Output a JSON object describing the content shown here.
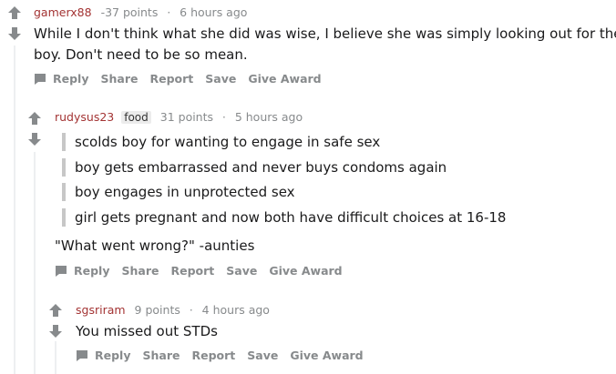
{
  "comments": [
    {
      "author": "gamerx88",
      "points": "-37 points",
      "time": "6 hours ago",
      "body_line1": "While I don't think what she did was wise, I believe she was simply looking out for the",
      "body_line2": "boy. Don't need to be so mean.",
      "actions": {
        "reply": "Reply",
        "share": "Share",
        "report": "Report",
        "save": "Save",
        "award": "Give Award"
      }
    },
    {
      "author": "rudysus23",
      "flair": "food",
      "points": "31 points",
      "time": "5 hours ago",
      "quotes": [
        "scolds boy for wanting to engage in safe sex",
        "boy gets embarrassed and never buys condoms again",
        "boy engages in unprotected sex",
        "girl gets pregnant and now both have difficult choices at 16-18"
      ],
      "body": "\"What went wrong?\" -aunties",
      "actions": {
        "reply": "Reply",
        "share": "Share",
        "report": "Report",
        "save": "Save",
        "award": "Give Award"
      }
    },
    {
      "author": "sgsriram",
      "points": "9 points",
      "time": "4 hours ago",
      "body": "You missed out STDs",
      "actions": {
        "reply": "Reply",
        "share": "Share",
        "report": "Report",
        "save": "Save",
        "award": "Give Award"
      }
    }
  ],
  "separator": "·",
  "icons": {
    "upvote": "upvote-arrow-icon",
    "downvote": "downvote-arrow-icon",
    "reply": "chat-bubble-icon"
  },
  "colors": {
    "author": "#a33333",
    "meta": "#878a8c",
    "arrow": "#878a8c",
    "quote_bar": "#c7c7c7"
  }
}
